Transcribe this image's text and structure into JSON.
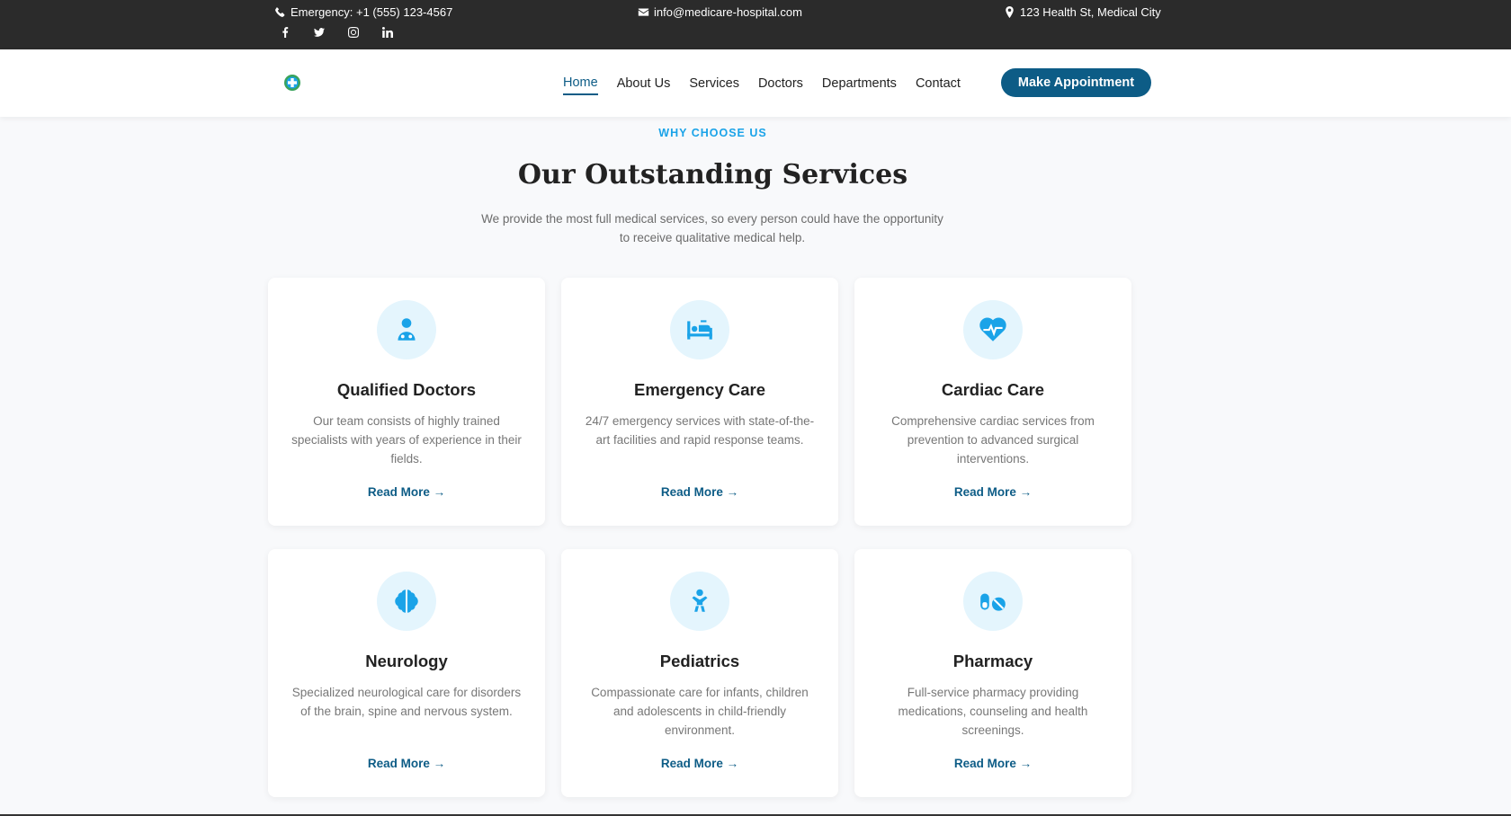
{
  "topbar": {
    "phone": "Emergency: +1 (555) 123-4567",
    "email": "info@medicare-hospital.com",
    "address": "123 Health St, Medical City",
    "socials": [
      "facebook-icon",
      "twitter-icon",
      "instagram-icon",
      "linkedin-icon"
    ]
  },
  "nav": {
    "links": [
      "Home",
      "About Us",
      "Services",
      "Doctors",
      "Departments",
      "Contact"
    ],
    "active": "Home",
    "cta": "Make Appointment"
  },
  "section": {
    "eyebrow": "WHY CHOOSE US",
    "title": "Our Outstanding Services",
    "subtitle_line1": "We provide the most full medical services, so every person could have the opportunity",
    "subtitle_line2": "to receive qualitative medical help."
  },
  "cards": [
    {
      "icon": "doctor-icon",
      "title": "Qualified Doctors",
      "desc": "Our team consists of highly trained specialists with years of experience in their fields.",
      "link": "Read More"
    },
    {
      "icon": "hospital-bed-icon",
      "title": "Emergency Care",
      "desc": "24/7 emergency services with state-of-the-art facilities and rapid response teams.",
      "link": "Read More"
    },
    {
      "icon": "heartbeat-icon",
      "title": "Cardiac Care",
      "desc": "Comprehensive cardiac services from prevention to advanced surgical interventions.",
      "link": "Read More"
    },
    {
      "icon": "brain-icon",
      "title": "Neurology",
      "desc": "Specialized neurological care for disorders of the brain, spine and nervous system.",
      "link": "Read More"
    },
    {
      "icon": "baby-icon",
      "title": "Pediatrics",
      "desc": "Compassionate care for infants, children and adolescents in child-friendly environment.",
      "link": "Read More"
    },
    {
      "icon": "pills-icon",
      "title": "Pharmacy",
      "desc": "Full-service pharmacy providing medications, counseling and health screenings.",
      "link": "Read More"
    }
  ],
  "colors": {
    "primary": "#0d5c86",
    "accent": "#1aa3e8",
    "topbar": "#2b2b2b"
  }
}
